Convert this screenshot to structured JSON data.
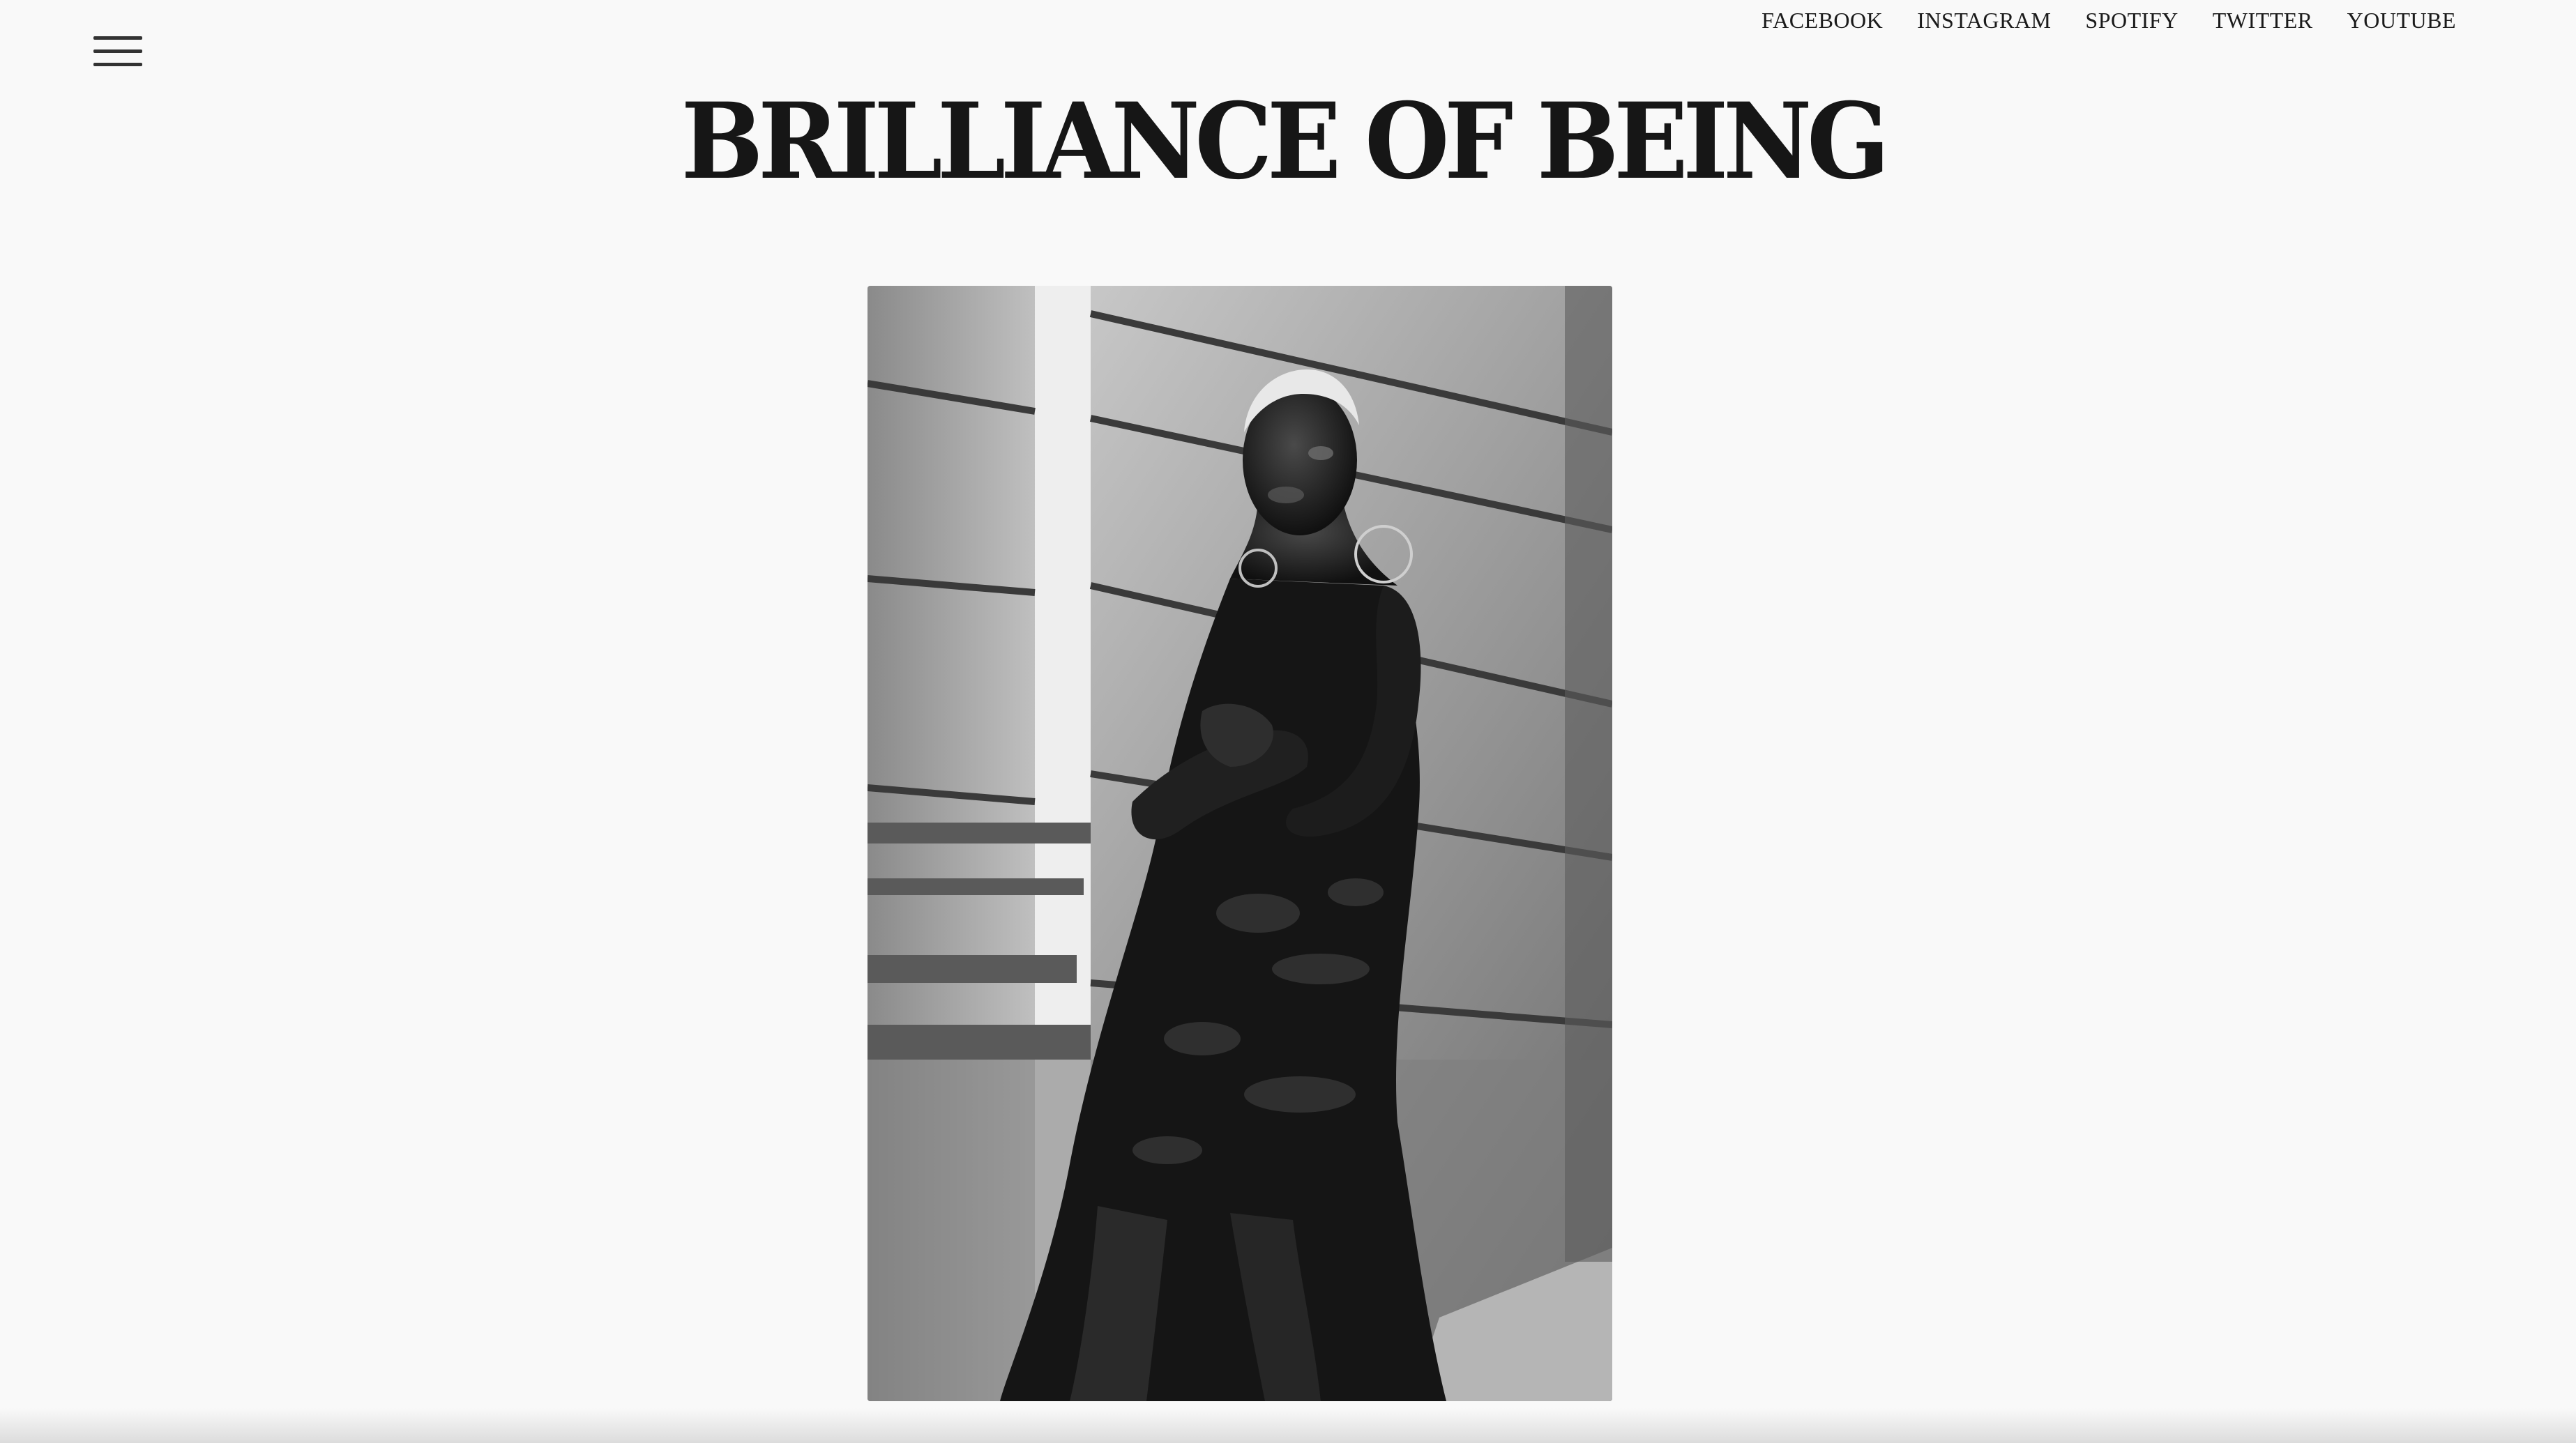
{
  "header": {
    "menu_icon": "hamburger-menu-icon",
    "site_title": "BRILLIANCE OF BEING"
  },
  "social_nav": {
    "items": [
      {
        "label": "FACEBOOK"
      },
      {
        "label": "INSTAGRAM"
      },
      {
        "label": "SPOTIFY"
      },
      {
        "label": "TWITTER"
      },
      {
        "label": "YOUTUBE"
      }
    ]
  },
  "featured_photo": {
    "style": "black-and-white portrait"
  },
  "colors": {
    "background": "#f9f9f9",
    "text": "#161616"
  }
}
